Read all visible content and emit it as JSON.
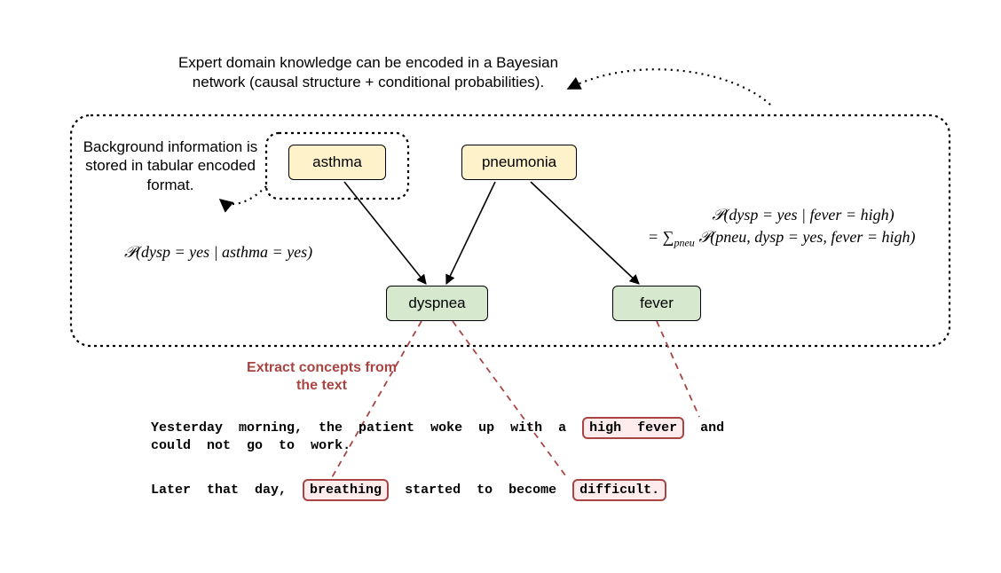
{
  "captions": {
    "top": "Expert domain knowledge can be encoded in a Bayesian network (causal structure + conditional probabilities).",
    "background": "Background information is stored in tabular encoded format.",
    "extract": "Extract concepts from the text"
  },
  "nodes": {
    "asthma": "asthma",
    "pneumonia": "pneumonia",
    "dyspnea": "dyspnea",
    "fever": "fever"
  },
  "formulas": {
    "left": "𝒫(dysp = yes | asthma = yes)",
    "right_line1": "𝒫(dysp = yes | fever = high)",
    "right_line2_prefix": "= ∑",
    "right_line2_sub": "pneu",
    "right_line2_rest": " 𝒫(pneu, dysp = yes, fever = high)"
  },
  "text": {
    "line1_words": [
      "Yesterday",
      "morning,",
      "the",
      "patient",
      "woke",
      "up",
      "with",
      "a"
    ],
    "line1_highlight": [
      "high",
      "fever"
    ],
    "line1_tail": [
      "and"
    ],
    "line2_words": [
      "could",
      "not",
      "go",
      "to",
      "work."
    ],
    "line3_pre": [
      "Later",
      "that",
      "day,"
    ],
    "line3_hl1": [
      "breathing"
    ],
    "line3_mid": [
      "started",
      "to",
      "become"
    ],
    "line3_hl2": [
      "difficult."
    ]
  }
}
